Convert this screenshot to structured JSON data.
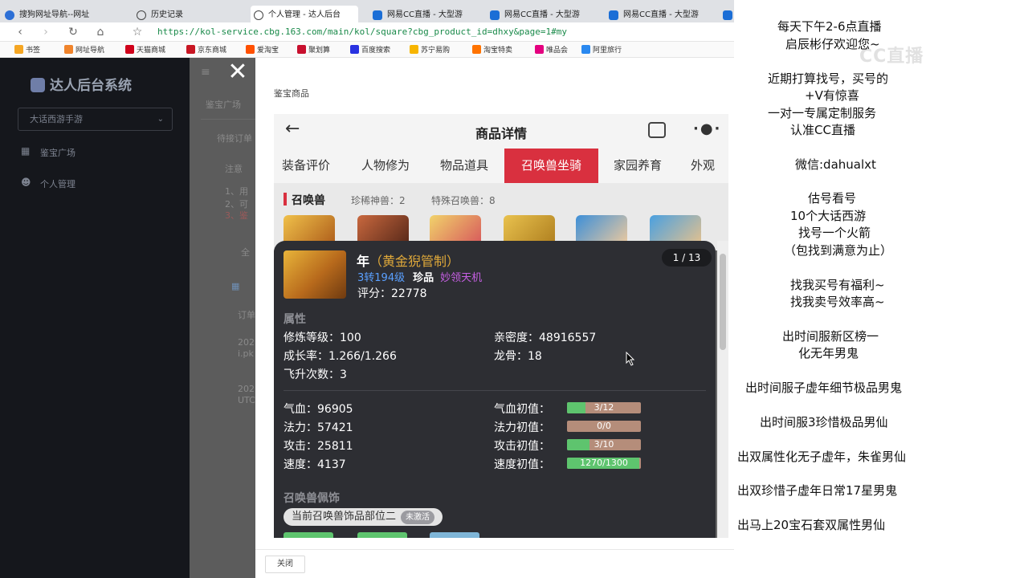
{
  "browser": {
    "tabs": [
      {
        "label": "搜狗网址导航--网址"
      },
      {
        "label": "历史记录"
      },
      {
        "label": "个人管理 - 达人后台"
      },
      {
        "label": "网易CC直播 - 大型游"
      },
      {
        "label": "网易CC直播 - 大型游"
      },
      {
        "label": "网易CC直播 - 大型游"
      }
    ],
    "url": "https://kol-service.cbg.163.com/main/kol/square?cbg_product_id=dhxy&page=1#my",
    "bookmarks": [
      "书签",
      "网址导航",
      "天猫商城",
      "京东商城",
      "爱淘宝",
      "聚划算",
      "百度搜索",
      "苏宁易购",
      "淘宝特卖",
      "唯品会",
      "阿里旅行"
    ]
  },
  "sidebar": {
    "brand": "达人后台系统",
    "game_select": "大话西游手游",
    "items": [
      {
        "label": "鉴宝广场"
      },
      {
        "label": "个人管理"
      }
    ]
  },
  "background": {
    "breadcrumb": "鉴宝广场",
    "pending": "待接订单",
    "note": "注意",
    "list_items": [
      "1、用",
      "2、可",
      "3、鉴"
    ],
    "filter": "全",
    "col_order": "订单",
    "row1_a": "202",
    "row1_b": "i.pk",
    "row2_a": "202",
    "row2_b": "UTC"
  },
  "modal": {
    "title": "鉴宝商品",
    "close_label": "关闭"
  },
  "phone": {
    "header_title": "商品详情",
    "tabs": [
      "装备评价",
      "人物修为",
      "物品道具",
      "召唤兽坐骑",
      "家园养育",
      "外观"
    ],
    "selected_tab": 3,
    "section_title": "召唤兽",
    "rare_count_label": "珍稀神兽：2",
    "special_count_label": "特殊召唤兽：8"
  },
  "pet_card": {
    "name": "年",
    "name_suffix": "（黄金猊管制）",
    "level": "3转194级",
    "rarity": "珍品",
    "skill": "妙领天机",
    "score": "评分：22778",
    "pager": "1 / 13",
    "attr_title": "属性",
    "attrs": {
      "cultivation": "修炼等级：100",
      "intimacy": "亲密度：48916557",
      "growth": "成长率：1.266/1.266",
      "dragon_bone": "龙骨：18",
      "ascension": "飞升次数：3"
    },
    "stats": {
      "hp": "气血：96905",
      "mp": "法力：57421",
      "atk": "攻击：25811",
      "spd": "速度：4137"
    },
    "initial_labels": {
      "hp": "气血初值：",
      "mp": "法力初值：",
      "atk": "攻击初值：",
      "spd": "速度初值："
    },
    "initial_bars": {
      "hp": {
        "text": "3/12",
        "fraction": 0.25
      },
      "mp": {
        "text": "0/0",
        "fraction": 0
      },
      "atk": {
        "text": "3/10",
        "fraction": 0.3
      },
      "spd": {
        "text": "1270/1300",
        "fraction": 0.977
      }
    },
    "accessory_title": "召唤兽佩饰",
    "accessory_pill": "当前召唤兽饰品部位二",
    "accessory_badge": "未激活"
  },
  "stream": {
    "watermark": "CC直播",
    "lines": [
      "每天下午2-6点直播",
      "启辰彬仔欢迎您~",
      "近期打算找号，买号的",
      "+V有惊喜",
      "一对一专属定制服务",
      "认准CC直播",
      "微信:dahualxt",
      "估号看号",
      "10个大话西游",
      "找号一个火箭",
      "（包找到满意为止）",
      "找我买号有福利~",
      "找我卖号效率高~",
      "出时间服新区榜一",
      "化无年男鬼",
      "出时间服子虚年细节极品男鬼",
      "出时间服3珍惜极品男仙",
      "出双属性化无子虚年，朱雀男仙",
      "出双珍惜子虚年日常17星男鬼",
      "出马上20宝石套双属性男仙"
    ]
  },
  "colors": {
    "accent_red": "#d9303f",
    "bar_green": "#5ec46e",
    "bar_bg": "#b58d7a",
    "level_blue": "#5aa0ff",
    "skill_purple": "#c65fe3",
    "gold": "#e0a93a"
  }
}
